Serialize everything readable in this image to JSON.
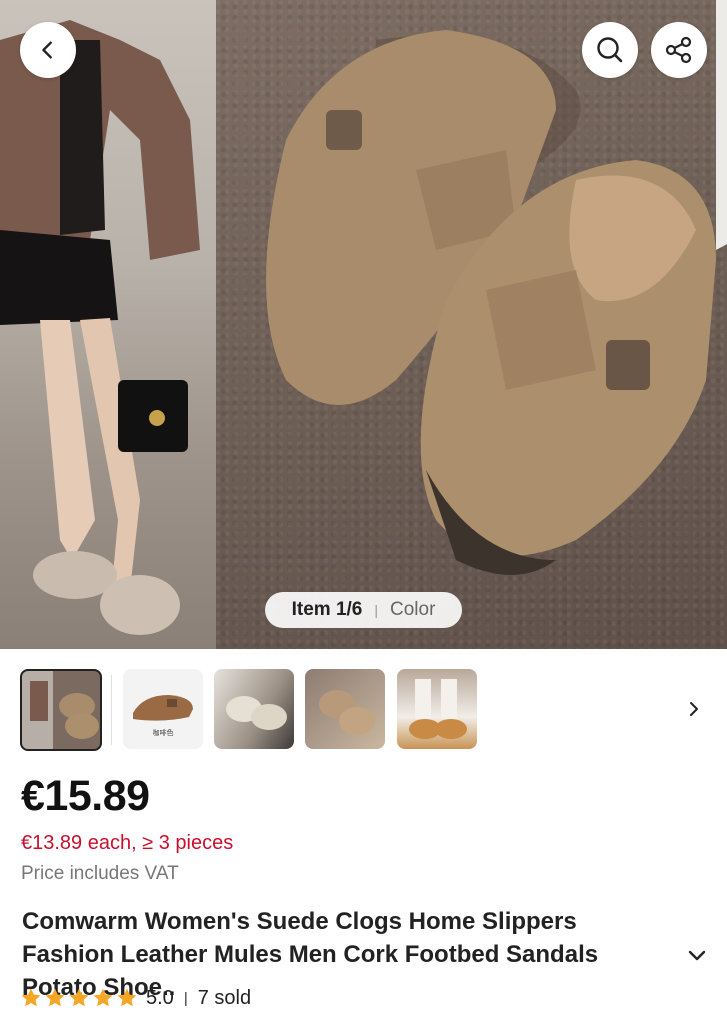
{
  "hero": {
    "item_label": "Item 1/6",
    "color_label": "Color",
    "icons": {
      "back": "chevron-left-icon",
      "search": "search-icon",
      "share": "share-icon"
    }
  },
  "thumbnails": {
    "count_visible": 5,
    "selected_index": 0,
    "thumb2_label": "咖啡色",
    "next_icon": "chevron-right-icon"
  },
  "product": {
    "price": "€15.89",
    "bulk_price": "€13.89 each, ≥ 3 pieces",
    "vat_note": "Price includes VAT",
    "title": "Comwarm Women's Suede Clogs Home Slippers Fashion Leather Mules Men Cork Footbed Sandals Potato Shoe..",
    "expand_icon": "chevron-down-icon"
  },
  "rating": {
    "stars": 5,
    "score": "5.0",
    "separator": "|",
    "sold": "7 sold",
    "star_color": "#f5a623"
  },
  "colors": {
    "accent_red": "#c8102e"
  }
}
